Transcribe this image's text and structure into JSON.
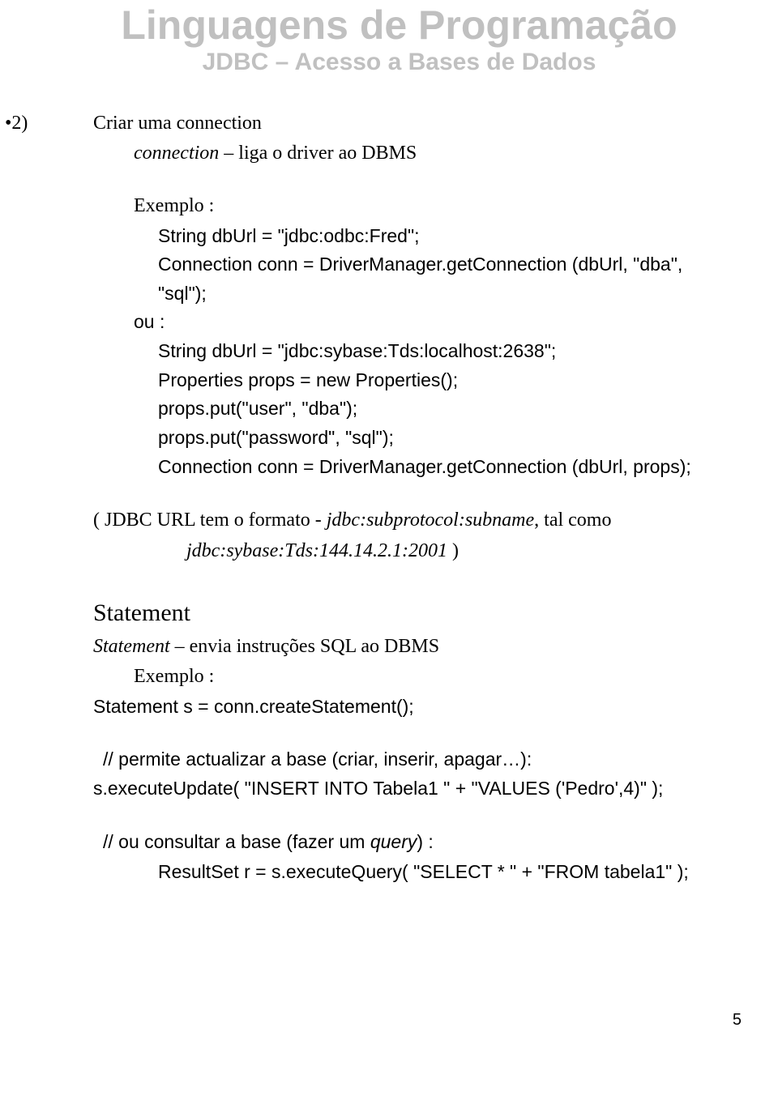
{
  "header": {
    "title": "Linguagens de Programação",
    "subtitle": "JDBC – Acesso a Bases de Dados"
  },
  "sec2": {
    "bullet": "•2)",
    "title": "Criar uma connection",
    "desc_pre": "connection",
    "desc_post": " – liga o driver ao DBMS",
    "example_label": "Exemplo :",
    "code1_l1": "String dbUrl = \"jdbc:odbc:Fred\";",
    "code1_l2": "Connection conn = DriverManager.getConnection (dbUrl, \"dba\", \"sql\");",
    "ou": "ou :",
    "code2_l1": "String dbUrl = \"jdbc:sybase:Tds:localhost:2638\";",
    "code2_l2": "Properties props = new Properties();",
    "code2_l3": "props.put(\"user\", \"dba\");",
    "code2_l4": "props.put(\"password\", \"sql\");",
    "code2_l5": "Connection conn = DriverManager.getConnection (dbUrl, props);"
  },
  "note": {
    "pre": "( JDBC URL tem o formato - ",
    "mid1": "jdbc:subprotocol:subname",
    "between": ", tal como",
    "mid2": "jdbc:sybase:Tds:144.14.2.1:2001",
    "post": " )"
  },
  "stmt": {
    "heading": "Statement",
    "desc_pre": "Statement",
    "desc_post": " – envia instruções SQL ao DBMS",
    "example_label": "Exemplo :",
    "code_l1": "Statement s = conn.createStatement();",
    "comment1": "// permite actualizar a base (criar, inserir, apagar…):",
    "code_l2": "s.executeUpdate( \"INSERT INTO Tabela1 \" + \"VALUES ('Pedro',4)\" );",
    "comment2_pre": "// ou consultar a base (fazer um ",
    "comment2_q": "query",
    "comment2_post": ") :",
    "code_l3": "ResultSet r = s.executeQuery( \"SELECT * \" + \"FROM tabela1\" );"
  },
  "page_number": "5"
}
